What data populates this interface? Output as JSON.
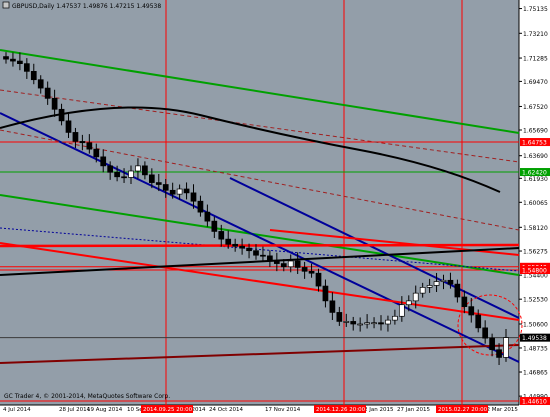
{
  "window": {
    "title": "GBPUSD,Daily  1.47537  1.49876  1.47215  1.49538",
    "copyright": "GC Trader 4, © 2001-2014, MetaQuotes Software Corp."
  },
  "colors": {
    "background": "#939ea9",
    "candle": "#000000",
    "grid_line": "#ff0000",
    "green_line": "#00a000",
    "blue_line": "#00009a",
    "black_line": "#000000",
    "dark_red_line": "#800000",
    "red_label": "#ff0000",
    "green_label": "#00a000",
    "current_label": "#000000"
  },
  "y_axis": {
    "ticks": [
      "1.75135",
      "1.73210",
      "1.71285",
      "1.69470",
      "1.67520",
      "1.65690",
      "1.63690",
      "1.61930",
      "1.60065",
      "1.58120",
      "1.56275",
      "1.54400",
      "1.52530",
      "1.50600",
      "1.48735",
      "1.46865",
      "1.44990"
    ]
  },
  "x_axis": {
    "ticks": [
      "4 Jul 2014",
      "28 Jul 2014",
      "19 Aug 2014",
      "10 Sep 2014",
      "2 Oct 2014",
      "24 Oct 2014",
      "17 Nov 2014",
      "9 Dec 2014",
      "2 Jan 2015",
      "27 Jan 2015",
      "18 Feb 2015",
      "12 Mar 2015"
    ],
    "highlighted": [
      "2014.09.25 20:00",
      "2014.12.26 20:00",
      "2015.02.27 20:00"
    ]
  },
  "price_labels": [
    {
      "text": "1.64753",
      "kind": "red"
    },
    {
      "text": "1.62420",
      "kind": "green"
    },
    {
      "text": "1.55049",
      "kind": "red"
    },
    {
      "text": "1.54800",
      "kind": "red"
    },
    {
      "text": "1.49538",
      "kind": "current"
    },
    {
      "text": "1.44610",
      "kind": "red"
    }
  ],
  "chart_data": {
    "type": "candlestick",
    "symbol": "GBPUSD",
    "timeframe": "Daily",
    "ohlc_current": {
      "open": 1.47537,
      "high": 1.49876,
      "low": 1.47215,
      "close": 1.49538
    },
    "ylim": [
      1.443,
      1.758
    ],
    "horizontal_levels": [
      1.64753,
      1.6242,
      1.55049,
      1.548,
      1.49538,
      1.4461
    ],
    "vertical_marks": [
      "2014.09.25 20:00",
      "2014.12.26 20:00",
      "2015.02.27 20:00"
    ],
    "close_series": [
      1.712,
      1.7105,
      1.7085,
      1.7025,
      1.696,
      1.6895,
      1.6815,
      1.673,
      1.664,
      1.655,
      1.648,
      1.647,
      1.642,
      1.636,
      1.629,
      1.624,
      1.6205,
      1.62,
      1.625,
      1.629,
      1.622,
      1.616,
      1.6145,
      1.61,
      1.607,
      1.611,
      1.608,
      1.6015,
      1.593,
      1.586,
      1.578,
      1.572,
      1.568,
      1.5665,
      1.565,
      1.563,
      1.5595,
      1.559,
      1.5555,
      1.553,
      1.5505,
      1.555,
      1.55,
      1.547,
      1.5455,
      1.5355,
      1.524,
      1.515,
      1.508,
      1.508,
      1.506,
      1.506,
      1.507,
      1.507,
      1.506,
      1.509,
      1.512,
      1.521,
      1.524,
      1.53,
      1.5345,
      1.536,
      1.539,
      1.54,
      1.537,
      1.527,
      1.5195,
      1.513,
      1.503,
      1.495,
      1.486,
      1.48,
      1.4954
    ]
  }
}
